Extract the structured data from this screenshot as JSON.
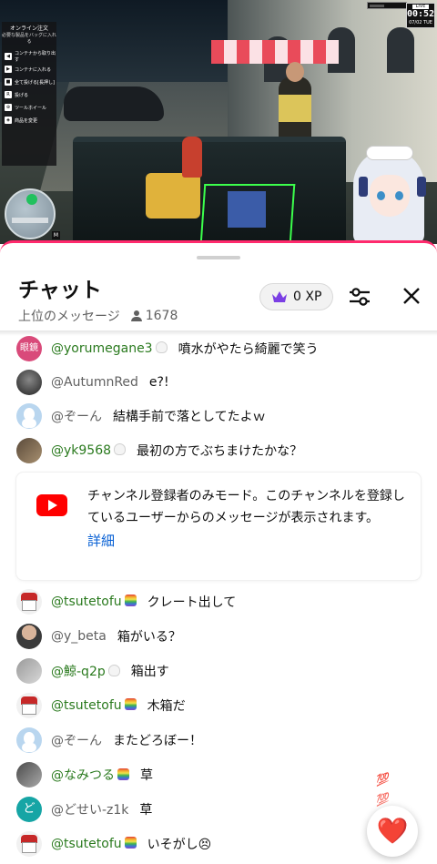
{
  "video": {
    "menu_title": "オンライン注文",
    "menu_hint": "必要な製品をバッグに入れる",
    "menu_items": [
      {
        "key": "◀",
        "label": "コンテナから取り出す"
      },
      {
        "key": "▶",
        "label": "コンテナに入れる"
      },
      {
        "key": "■",
        "label": "全て投げる[長押し]"
      },
      {
        "key": "R",
        "label": "投げる"
      },
      {
        "key": "⊕",
        "label": "ツールホイール"
      },
      {
        "key": "◈",
        "label": "商品を変更"
      }
    ],
    "minimap_key": "M",
    "live_label": "LIVE",
    "clock_time": "00:52",
    "clock_date": "07/02 TUE"
  },
  "chat": {
    "title": "チャット",
    "mode": "上位のメッセージ",
    "viewers": "1678",
    "xp_label": "0 XP",
    "notice": {
      "text": "チャンネル登録者のみモード。このチャンネルを登録しているユーザーからのメッセージが表示されます。",
      "link": "詳細"
    },
    "messages": [
      {
        "author": "@yorumegane3",
        "text": "噴水がやたら綺麗で笑う",
        "avatar_text": "眼鏡"
      },
      {
        "author": "@AutumnRed",
        "text": "e?!"
      },
      {
        "author": "@ぞーん",
        "text": "結構手前で落としてたよｗ"
      },
      {
        "author": "@yk9568",
        "text": "最初の方でぶちまけたかな？"
      },
      {
        "author": "@tsutetofu",
        "text": "クレート出して"
      },
      {
        "author": "@y_beta",
        "text": "箱がいる？"
      },
      {
        "author": "@鯨-q2p",
        "text": "箱出す"
      },
      {
        "author": "@tsutetofu",
        "text": "木箱だ"
      },
      {
        "author": "@ぞーん",
        "text": "またどろぼー！"
      },
      {
        "author": "@なみつる",
        "text": "草"
      },
      {
        "author": "@どせい-z1k",
        "text": "草",
        "avatar_text": "ど"
      },
      {
        "author": "@tsutetofu",
        "text": "いそがし😣"
      }
    ],
    "reaction_emoji": "💯",
    "heart_emoji": "❤️"
  },
  "colors": {
    "accent_border": "#ff2a6d",
    "member_name": "#2a7a1e",
    "link": "#065fd4",
    "youtube_red": "#ff0000"
  }
}
